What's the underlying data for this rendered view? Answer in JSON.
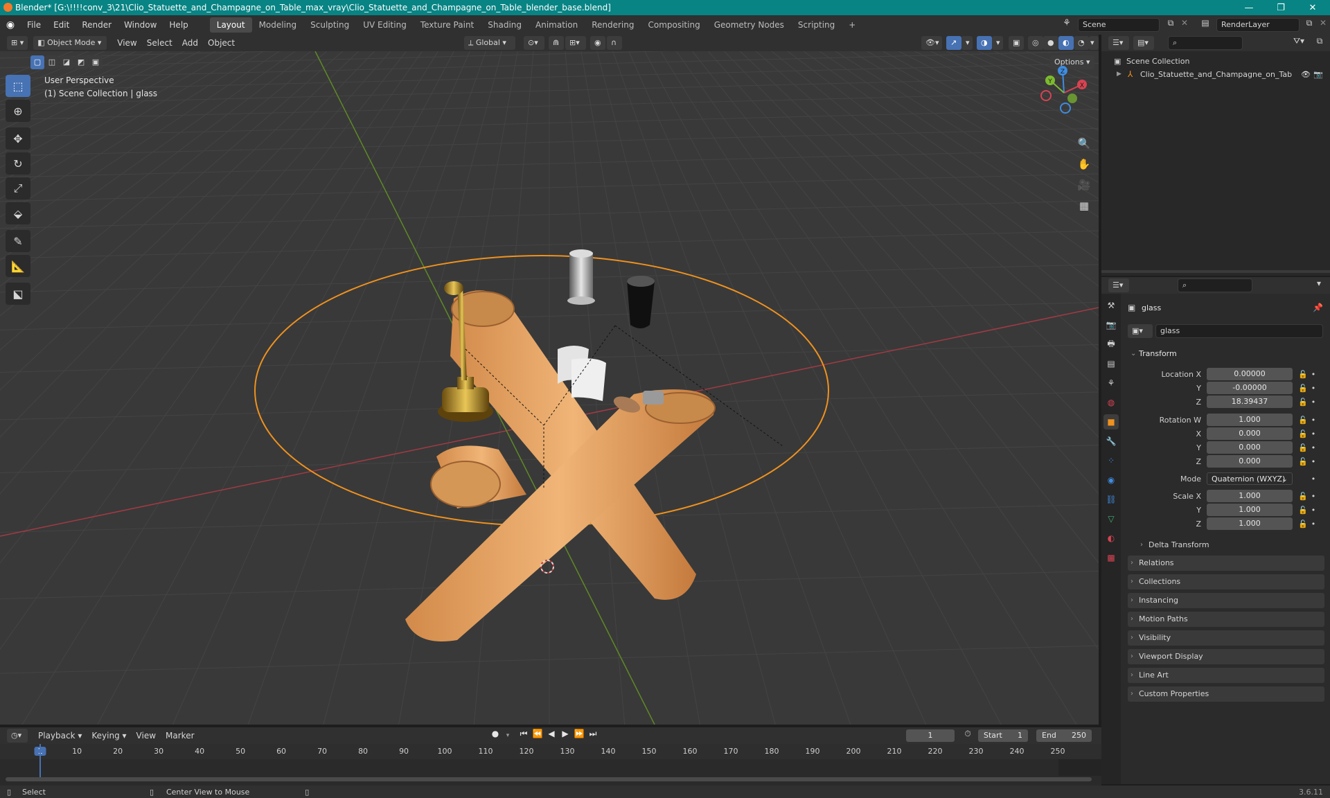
{
  "window": {
    "title": "Blender* [G:\\!!!!conv_3\\21\\Clio_Statuette_and_Champagne_on_Table_max_vray\\Clio_Statuette_and_Champagne_on_Table_blender_base.blend]",
    "minimize": "—",
    "maximize": "❐",
    "close": "✕"
  },
  "menu": [
    "File",
    "Edit",
    "Render",
    "Window",
    "Help"
  ],
  "workspaces": [
    "Layout",
    "Modeling",
    "Sculpting",
    "UV Editing",
    "Texture Paint",
    "Shading",
    "Animation",
    "Rendering",
    "Compositing",
    "Geometry Nodes",
    "Scripting"
  ],
  "workspace_add": "+",
  "scene": {
    "name": "Scene",
    "view_layer": "RenderLayer"
  },
  "viewport_header": {
    "mode": "Object Mode",
    "menus": [
      "View",
      "Select",
      "Add",
      "Object"
    ],
    "orientation": "Global",
    "options": "Options"
  },
  "viewport": {
    "perspective": "User Perspective",
    "collection_info": "(1) Scene Collection | glass",
    "gizmo": {
      "x": "X",
      "y": "Y",
      "z": "Z"
    }
  },
  "outliner": {
    "root": "Scene Collection",
    "items": [
      {
        "label": "Clio_Statuette_and_Champagne_on_Tab"
      }
    ]
  },
  "properties": {
    "object_name": "glass",
    "data_name": "glass",
    "transform_header": "Transform",
    "location": {
      "label_x": "Location X",
      "label_y": "Y",
      "label_z": "Z",
      "x": "0.00000",
      "y": "-0.00000",
      "z": "18.39437"
    },
    "rotation": {
      "label_w": "Rotation W",
      "label_x": "X",
      "label_y": "Y",
      "label_z": "Z",
      "w": "1.000",
      "x": "0.000",
      "y": "0.000",
      "z": "0.000"
    },
    "mode_label": "Mode",
    "mode_value": "Quaternion (WXYZ)",
    "scale": {
      "label_x": "Scale X",
      "label_y": "Y",
      "label_z": "Z",
      "x": "1.000",
      "y": "1.000",
      "z": "1.000"
    },
    "delta_transform": "Delta Transform",
    "panels": [
      "Relations",
      "Collections",
      "Instancing",
      "Motion Paths",
      "Visibility",
      "Viewport Display",
      "Line Art",
      "Custom Properties"
    ]
  },
  "timeline": {
    "menus": [
      "Playback",
      "Keying",
      "View",
      "Marker"
    ],
    "current_frame": "1",
    "start_label": "Start",
    "start": "1",
    "end_label": "End",
    "end": "250",
    "ruler": [
      "1",
      "10",
      "20",
      "30",
      "40",
      "50",
      "60",
      "70",
      "80",
      "90",
      "100",
      "110",
      "120",
      "130",
      "140",
      "150",
      "160",
      "170",
      "180",
      "190",
      "200",
      "210",
      "220",
      "230",
      "240",
      "250"
    ]
  },
  "statusbar": {
    "select": "Select",
    "center_view": "Center View to Mouse",
    "version": "3.6.11"
  },
  "colors": {
    "accent": "#4772b3",
    "title_bar": "#088484",
    "selection_outline": "#f0921e",
    "x_axis": "#b03c46",
    "y_axis": "#6c9a2a"
  }
}
